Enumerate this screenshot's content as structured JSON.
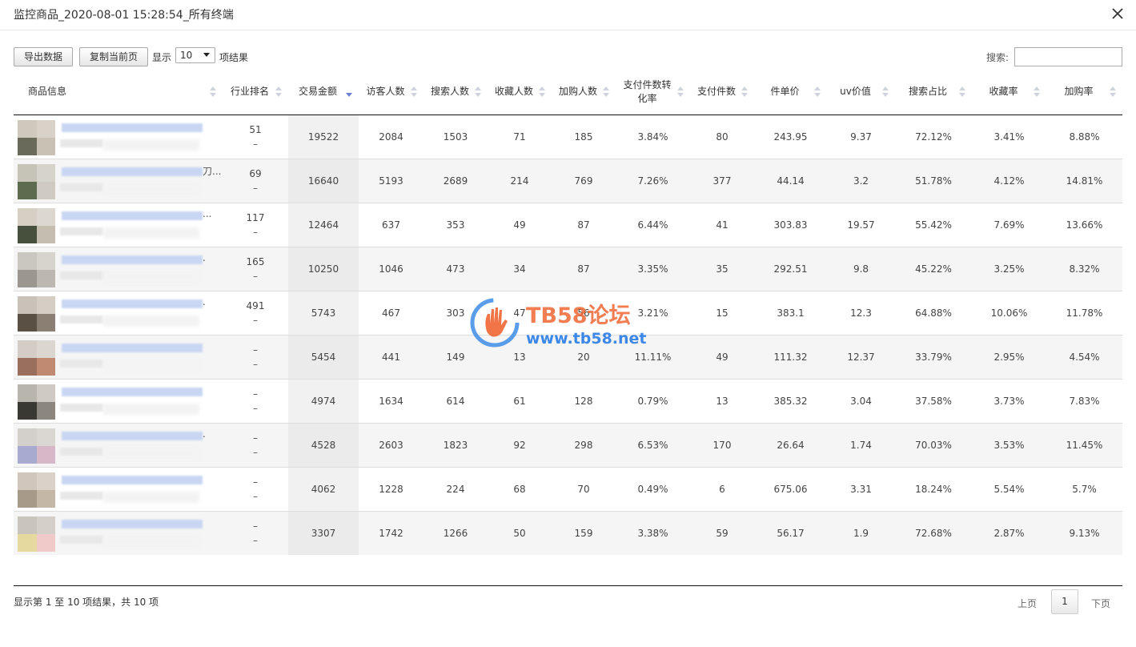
{
  "window": {
    "title": "监控商品_2020-08-01 15:28:54_所有终端"
  },
  "toolbar": {
    "export_label": "导出数据",
    "copy_label": "复制当前页",
    "show_label": "显示",
    "page_size": "10",
    "result_label": "项结果",
    "search_label": "搜索:",
    "search_value": ""
  },
  "columns": [
    "商品信息",
    "行业排名",
    "交易金额",
    "访客人数",
    "搜索人数",
    "收藏人数",
    "加购人数",
    "支付件数转化率",
    "支付件数",
    "件单价",
    "uv价值",
    "搜索占比",
    "收藏率",
    "加购率"
  ],
  "sorted_column": "交易金额",
  "rows": [
    {
      "rank": "51",
      "rank_change": "–",
      "amount": "19522",
      "visitors": "2084",
      "searchers": "1503",
      "favorites": "71",
      "carts": "185",
      "conv": "3.84%",
      "pay_qty": "80",
      "unit_price": "243.95",
      "uv_value": "9.37",
      "search_ratio": "72.12%",
      "fav_rate": "3.41%",
      "cart_rate": "8.88%",
      "title_suffix": ""
    },
    {
      "rank": "69",
      "rank_change": "–",
      "amount": "16640",
      "visitors": "5193",
      "searchers": "2689",
      "favorites": "214",
      "carts": "769",
      "conv": "7.26%",
      "pay_qty": "377",
      "unit_price": "44.14",
      "uv_value": "3.2",
      "search_ratio": "51.78%",
      "fav_rate": "4.12%",
      "cart_rate": "14.81%",
      "title_suffix": "刀..."
    },
    {
      "rank": "117",
      "rank_change": "–",
      "amount": "12464",
      "visitors": "637",
      "searchers": "353",
      "favorites": "49",
      "carts": "87",
      "conv": "6.44%",
      "pay_qty": "41",
      "unit_price": "303.83",
      "uv_value": "19.57",
      "search_ratio": "55.42%",
      "fav_rate": "7.69%",
      "cart_rate": "13.66%",
      "title_suffix": "..."
    },
    {
      "rank": "165",
      "rank_change": "–",
      "amount": "10250",
      "visitors": "1046",
      "searchers": "473",
      "favorites": "34",
      "carts": "87",
      "conv": "3.35%",
      "pay_qty": "35",
      "unit_price": "292.51",
      "uv_value": "9.8",
      "search_ratio": "45.22%",
      "fav_rate": "3.25%",
      "cart_rate": "8.32%",
      "title_suffix": "."
    },
    {
      "rank": "491",
      "rank_change": "–",
      "amount": "5743",
      "visitors": "467",
      "searchers": "303",
      "favorites": "47",
      "carts": "56",
      "conv": "3.21%",
      "pay_qty": "15",
      "unit_price": "383.1",
      "uv_value": "12.3",
      "search_ratio": "64.88%",
      "fav_rate": "10.06%",
      "cart_rate": "11.78%",
      "title_suffix": "."
    },
    {
      "rank": "–",
      "rank_change": "–",
      "amount": "5454",
      "visitors": "441",
      "searchers": "149",
      "favorites": "13",
      "carts": "20",
      "conv": "11.11%",
      "pay_qty": "49",
      "unit_price": "111.32",
      "uv_value": "12.37",
      "search_ratio": "33.79%",
      "fav_rate": "2.95%",
      "cart_rate": "4.54%",
      "title_suffix": ""
    },
    {
      "rank": "–",
      "rank_change": "–",
      "amount": "4974",
      "visitors": "1634",
      "searchers": "614",
      "favorites": "61",
      "carts": "128",
      "conv": "0.79%",
      "pay_qty": "13",
      "unit_price": "385.32",
      "uv_value": "3.04",
      "search_ratio": "37.58%",
      "fav_rate": "3.73%",
      "cart_rate": "7.83%",
      "title_suffix": ""
    },
    {
      "rank": "–",
      "rank_change": "–",
      "amount": "4528",
      "visitors": "2603",
      "searchers": "1823",
      "favorites": "92",
      "carts": "298",
      "conv": "6.53%",
      "pay_qty": "170",
      "unit_price": "26.64",
      "uv_value": "1.74",
      "search_ratio": "70.03%",
      "fav_rate": "3.53%",
      "cart_rate": "11.45%",
      "title_suffix": "."
    },
    {
      "rank": "–",
      "rank_change": "–",
      "amount": "4062",
      "visitors": "1228",
      "searchers": "224",
      "favorites": "68",
      "carts": "70",
      "conv": "0.49%",
      "pay_qty": "6",
      "unit_price": "675.06",
      "uv_value": "3.31",
      "search_ratio": "18.24%",
      "fav_rate": "5.54%",
      "cart_rate": "5.7%",
      "title_suffix": ""
    },
    {
      "rank": "–",
      "rank_change": "–",
      "amount": "3307",
      "visitors": "1742",
      "searchers": "1266",
      "favorites": "50",
      "carts": "159",
      "conv": "3.38%",
      "pay_qty": "59",
      "unit_price": "56.17",
      "uv_value": "1.9",
      "search_ratio": "72.68%",
      "fav_rate": "2.87%",
      "cart_rate": "9.13%",
      "title_suffix": ""
    }
  ],
  "thumb_colors": [
    [
      "#cfc8bc",
      "#d8d2c8",
      "#6a6a5a",
      "#c8c1b4"
    ],
    [
      "#c6c3b7",
      "#d6d3cb",
      "#5d6b4e",
      "#cfcbc2"
    ],
    [
      "#d5cfc4",
      "#ddd8cf",
      "#47503d",
      "#c4bdb0"
    ],
    [
      "#cac6c0",
      "#d7d3cd",
      "#9b9790",
      "#bcb8b1"
    ],
    [
      "#c9c2b8",
      "#d4cec5",
      "#5b5044",
      "#8a7f72"
    ],
    [
      "#d4cdc6",
      "#dcd6d0",
      "#9a6f5d",
      "#c08a72"
    ],
    [
      "#b8b5ac",
      "#cfcbc4",
      "#3a3833",
      "#8b877e"
    ],
    [
      "#d3cfca",
      "#dad6d1",
      "#a9aad0",
      "#d8b8c8"
    ],
    [
      "#d0c6bb",
      "#dad2c9",
      "#a89a89",
      "#c4b7a6"
    ],
    [
      "#c9c4bc",
      "#d4cfc8",
      "#e6d9a0",
      "#f0c9c9"
    ]
  ],
  "footer": {
    "info": "显示第 1 至 10 项结果，共 10 项",
    "prev": "上页",
    "current_page": "1",
    "next": "下页"
  },
  "watermark": {
    "line1": "TB58论坛",
    "line2": "www.tb58.net"
  },
  "colors": {
    "sort_active": "#6c7fd6",
    "watermark_orange": "#ef6632",
    "watermark_blue": "#1b74e6"
  }
}
